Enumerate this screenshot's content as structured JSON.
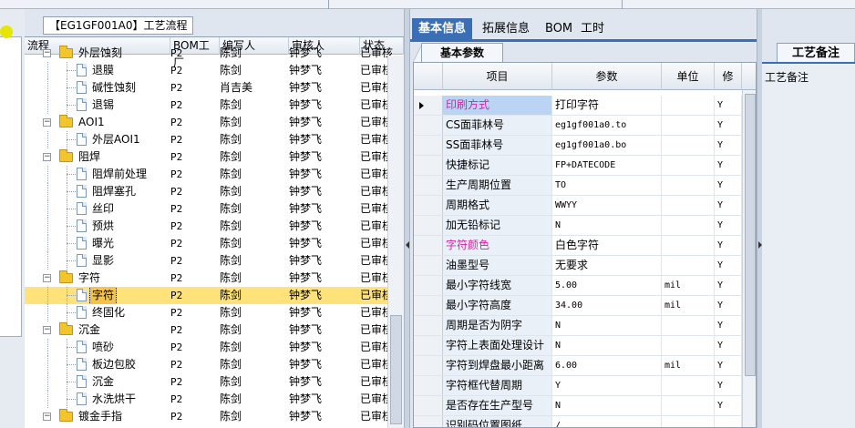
{
  "tree": {
    "title": "【EG1GF001A0】工艺流程",
    "columns": [
      "流程",
      "BOM工厂",
      "编写人",
      "审核人",
      "状态"
    ],
    "rows": [
      {
        "name": "外层蚀刻",
        "level": 1,
        "folder": true,
        "bom": "P2",
        "author": "陈剑",
        "reviewer": "钟梦飞",
        "status": "已审核"
      },
      {
        "name": "退膜",
        "level": 2,
        "folder": false,
        "bom": "P2",
        "author": "陈剑",
        "reviewer": "钟梦飞",
        "status": "已审核"
      },
      {
        "name": "碱性蚀刻",
        "level": 2,
        "folder": false,
        "bom": "P2",
        "author": "肖吉美",
        "reviewer": "钟梦飞",
        "status": "已审核"
      },
      {
        "name": "退锡",
        "level": 2,
        "folder": false,
        "bom": "P2",
        "author": "陈剑",
        "reviewer": "钟梦飞",
        "status": "已审核"
      },
      {
        "name": "AOI1",
        "level": 1,
        "folder": true,
        "bom": "P2",
        "author": "陈剑",
        "reviewer": "钟梦飞",
        "status": "已审核"
      },
      {
        "name": "外层AOI1",
        "level": 2,
        "folder": false,
        "bom": "P2",
        "author": "陈剑",
        "reviewer": "钟梦飞",
        "status": "已审核"
      },
      {
        "name": "阻焊",
        "level": 1,
        "folder": true,
        "bom": "P2",
        "author": "陈剑",
        "reviewer": "钟梦飞",
        "status": "已审核"
      },
      {
        "name": "阻焊前处理",
        "level": 2,
        "folder": false,
        "bom": "P2",
        "author": "陈剑",
        "reviewer": "钟梦飞",
        "status": "已审核"
      },
      {
        "name": "阻焊塞孔",
        "level": 2,
        "folder": false,
        "bom": "P2",
        "author": "陈剑",
        "reviewer": "钟梦飞",
        "status": "已审核"
      },
      {
        "name": "丝印",
        "level": 2,
        "folder": false,
        "bom": "P2",
        "author": "陈剑",
        "reviewer": "钟梦飞",
        "status": "已审核"
      },
      {
        "name": "预烘",
        "level": 2,
        "folder": false,
        "bom": "P2",
        "author": "陈剑",
        "reviewer": "钟梦飞",
        "status": "已审核"
      },
      {
        "name": "曝光",
        "level": 2,
        "folder": false,
        "bom": "P2",
        "author": "陈剑",
        "reviewer": "钟梦飞",
        "status": "已审核"
      },
      {
        "name": "显影",
        "level": 2,
        "folder": false,
        "bom": "P2",
        "author": "陈剑",
        "reviewer": "钟梦飞",
        "status": "已审核"
      },
      {
        "name": "字符",
        "level": 1,
        "folder": true,
        "bom": "P2",
        "author": "陈剑",
        "reviewer": "钟梦飞",
        "status": "已审核"
      },
      {
        "name": "字符",
        "level": 2,
        "folder": false,
        "bom": "P2",
        "author": "陈剑",
        "reviewer": "钟梦飞",
        "status": "已审核",
        "selected": true
      },
      {
        "name": "终固化",
        "level": 2,
        "folder": false,
        "bom": "P2",
        "author": "陈剑",
        "reviewer": "钟梦飞",
        "status": "已审核"
      },
      {
        "name": "沉金",
        "level": 1,
        "folder": true,
        "bom": "P2",
        "author": "陈剑",
        "reviewer": "钟梦飞",
        "status": "已审核"
      },
      {
        "name": "喷砂",
        "level": 2,
        "folder": false,
        "bom": "P2",
        "author": "陈剑",
        "reviewer": "钟梦飞",
        "status": "已审核"
      },
      {
        "name": "板边包胶",
        "level": 2,
        "folder": false,
        "bom": "P2",
        "author": "陈剑",
        "reviewer": "钟梦飞",
        "status": "已审核"
      },
      {
        "name": "沉金",
        "level": 2,
        "folder": false,
        "bom": "P2",
        "author": "陈剑",
        "reviewer": "钟梦飞",
        "status": "已审核"
      },
      {
        "name": "水洗烘干",
        "level": 2,
        "folder": false,
        "bom": "P2",
        "author": "陈剑",
        "reviewer": "钟梦飞",
        "status": "已审核"
      },
      {
        "name": "镀金手指",
        "level": 1,
        "folder": true,
        "bom": "P2",
        "author": "陈剑",
        "reviewer": "钟梦飞",
        "status": "已审核"
      }
    ]
  },
  "main": {
    "tabs": [
      "基本信息",
      "拓展信息",
      "BOM",
      "工时"
    ],
    "active_tab": 0,
    "subtab": "基本参数",
    "columns": [
      "项目",
      "参数",
      "单位",
      "修"
    ],
    "rows": [
      {
        "item": "印刷方式",
        "param": "打印字符",
        "unit": "",
        "mod": "Y",
        "pink": true,
        "mono": false
      },
      {
        "item": "CS面菲林号",
        "param": "eg1gf001a0.to",
        "unit": "",
        "mod": "Y",
        "pink": false,
        "mono": true
      },
      {
        "item": "SS面菲林号",
        "param": "eg1gf001a0.bo",
        "unit": "",
        "mod": "Y",
        "pink": false,
        "mono": true
      },
      {
        "item": "快捷标记",
        "param": "FP+DATECODE",
        "unit": "",
        "mod": "Y",
        "pink": false,
        "mono": true
      },
      {
        "item": "生产周期位置",
        "param": "TO",
        "unit": "",
        "mod": "Y",
        "pink": false,
        "mono": true
      },
      {
        "item": "周期格式",
        "param": "WWYY",
        "unit": "",
        "mod": "Y",
        "pink": false,
        "mono": true
      },
      {
        "item": "加无铅标记",
        "param": "N",
        "unit": "",
        "mod": "Y",
        "pink": false,
        "mono": true
      },
      {
        "item": "字符颜色",
        "param": "白色字符",
        "unit": "",
        "mod": "Y",
        "pink": true,
        "mono": false
      },
      {
        "item": "油墨型号",
        "param": "无要求",
        "unit": "",
        "mod": "Y",
        "pink": false,
        "mono": false
      },
      {
        "item": "最小字符线宽",
        "param": "5.00",
        "unit": "mil",
        "mod": "Y",
        "pink": false,
        "mono": true
      },
      {
        "item": "最小字符高度",
        "param": "34.00",
        "unit": "mil",
        "mod": "Y",
        "pink": false,
        "mono": true
      },
      {
        "item": "周期是否为阴字",
        "param": "N",
        "unit": "",
        "mod": "Y",
        "pink": false,
        "mono": true
      },
      {
        "item": "字符上表面处理设计",
        "param": "N",
        "unit": "",
        "mod": "Y",
        "pink": false,
        "mono": true
      },
      {
        "item": "字符到焊盘最小距离",
        "param": "6.00",
        "unit": "mil",
        "mod": "Y",
        "pink": false,
        "mono": true
      },
      {
        "item": "字符框代替周期",
        "param": "Y",
        "unit": "",
        "mod": "Y",
        "pink": false,
        "mono": true
      },
      {
        "item": "是否存在生产型号",
        "param": "N",
        "unit": "",
        "mod": "Y",
        "pink": false,
        "mono": true
      },
      {
        "item": "识别码位置图纸",
        "param": "/",
        "unit": "",
        "mod": "",
        "pink": false,
        "mono": true
      }
    ]
  },
  "remarks": {
    "tab": "工艺备注",
    "label": "工艺备注"
  },
  "colors": {
    "tab_active": "#3a6fb5",
    "selected_row": "#ffe27a",
    "pink_label": "#d323a8",
    "folder": "#f3c52c"
  }
}
